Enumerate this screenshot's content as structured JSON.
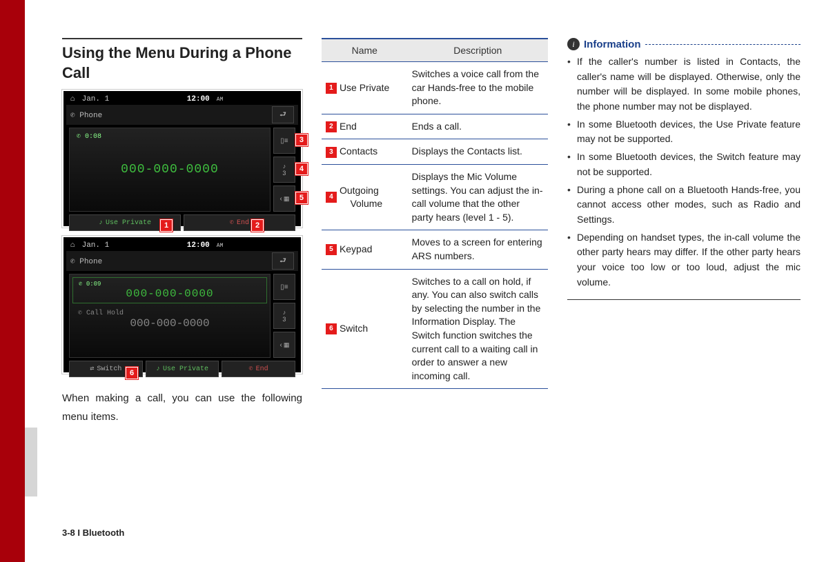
{
  "page_footer": "3-8 I Bluetooth",
  "heading": "Using the Menu During a Phone Call",
  "body_text": "When making a call, you can use the following menu items.",
  "screenshot1": {
    "date": "Jan. 1",
    "time": "12:00",
    "ampm": "AM",
    "tab": "Phone",
    "duration": "0:08",
    "number": "000-000-0000",
    "btn_use_private": "Use Private",
    "btn_end": "End",
    "mic_level": "3"
  },
  "screenshot2": {
    "date": "Jan. 1",
    "time": "12:00",
    "ampm": "AM",
    "tab": "Phone",
    "duration": "0:09",
    "number_active": "000-000-0000",
    "call_hold": "Call Hold",
    "number_hold": "000-000-0000",
    "btn_switch": "Switch",
    "btn_use_private": "Use Private",
    "btn_end": "End",
    "mic_level": "3"
  },
  "callouts": {
    "c1": "1",
    "c2": "2",
    "c3": "3",
    "c4": "4",
    "c5": "5",
    "c6": "6"
  },
  "table": {
    "head_name": "Name",
    "head_desc": "Description",
    "rows": [
      {
        "num": "1",
        "name": "Use Private",
        "desc": "Switches a voice call from the car Hands-free to the mobile phone."
      },
      {
        "num": "2",
        "name": "End",
        "desc": "Ends a call."
      },
      {
        "num": "3",
        "name": "Contacts",
        "desc": "Displays the Contacts list."
      },
      {
        "num": "4",
        "name": "Outgoing Volume",
        "desc": "Displays the Mic Volume settings. You can adjust the in-call volume that the other party hears (level 1 - 5)."
      },
      {
        "num": "5",
        "name": "Keypad",
        "desc": "Moves to a screen for entering ARS numbers."
      },
      {
        "num": "6",
        "name": "Switch",
        "desc": "Switches to a call on hold, if any. You can also switch calls by selecting the number in the Information Display. The Switch function switches the current call to a waiting call in order to answer a new incoming call."
      }
    ]
  },
  "info": {
    "title": "Information",
    "items": [
      "If the caller's number is listed in Contacts, the caller's name will be displayed. Otherwise, only the number will be displayed. In some mobile phones, the phone number may not be displayed.",
      "In some Bluetooth devices, the Use Private feature may not be supported.",
      "In some Bluetooth devices, the Switch feature may not be supported.",
      "During a phone call on a Bluetooth Hands-free, you cannot access other modes, such as Radio and Settings.",
      "Depending on handset types, the in-call volume the other party hears may differ. If the other party hears your voice too low or too loud, adjust the mic volume."
    ]
  }
}
